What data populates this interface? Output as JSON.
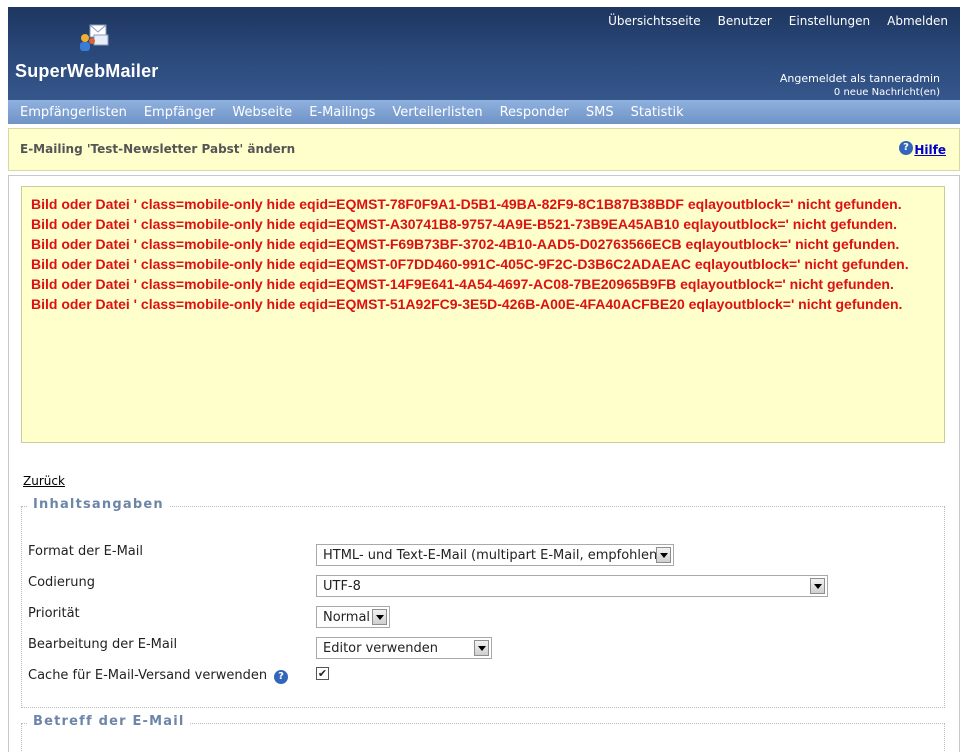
{
  "header": {
    "brand": "SuperWebMailer",
    "top_links": [
      "Übersichtsseite",
      "Benutzer",
      "Einstellungen",
      "Abmelden"
    ],
    "login_info": "Angemeldet als tanneradmin",
    "messages_info": "0 neue Nachricht(en)"
  },
  "nav": {
    "items": [
      "Empfängerlisten",
      "Empfänger",
      "Webseite",
      "E-Mailings",
      "Verteilerlisten",
      "Responder",
      "SMS",
      "Statistik"
    ]
  },
  "titlebar": {
    "title": "E-Mailing 'Test-Newsletter Pabst' ändern",
    "help_label": "Hilfe",
    "help_icon_glyph": "?"
  },
  "errors": [
    "Bild oder Datei ' class=mobile-only hide eqid=EQMST-78F0F9A1-D5B1-49BA-82F9-8C1B87B38BDF eqlayoutblock=' nicht gefunden.",
    "Bild oder Datei ' class=mobile-only hide eqid=EQMST-A30741B8-9757-4A9E-B521-73B9EA45AB10 eqlayoutblock=' nicht gefunden.",
    "Bild oder Datei ' class=mobile-only hide eqid=EQMST-F69B73BF-3702-4B10-AAD5-D02763566ECB eqlayoutblock=' nicht gefunden.",
    "Bild oder Datei ' class=mobile-only hide eqid=EQMST-0F7DD460-991C-405C-9F2C-D3B6C2ADAEAC eqlayoutblock=' nicht gefunden.",
    "Bild oder Datei ' class=mobile-only hide eqid=EQMST-14F9E641-4A54-4697-AC08-7BE20965B9FB eqlayoutblock=' nicht gefunden.",
    "Bild oder Datei ' class=mobile-only hide eqid=EQMST-51A92FC9-3E5D-426B-A00E-4FA40ACFBE20 eqlayoutblock=' nicht gefunden."
  ],
  "back_link": "Zurück",
  "content_section": {
    "legend": "Inhaltsangaben",
    "format_label": "Format der E-Mail",
    "format_value": "HTML- und Text-E-Mail (multipart E-Mail, empfohlen)",
    "encoding_label": "Codierung",
    "encoding_value": "UTF-8",
    "priority_label": "Priorität",
    "priority_value": "Normal",
    "editing_label": "Bearbeitung der E-Mail",
    "editing_value": "Editor verwenden",
    "cache_label": "Cache für E-Mail-Versand verwenden",
    "cache_checked_glyph": "✔",
    "help_icon_glyph": "?"
  },
  "subject_section": {
    "legend": "Betreff der E-Mail"
  },
  "colors": {
    "header_bg": "#2b4a7c",
    "nav_bg": "#7fa2d4",
    "notice_bg": "#ffffcc",
    "error_text": "#dd1111",
    "legend_text": "#6d86a8"
  }
}
